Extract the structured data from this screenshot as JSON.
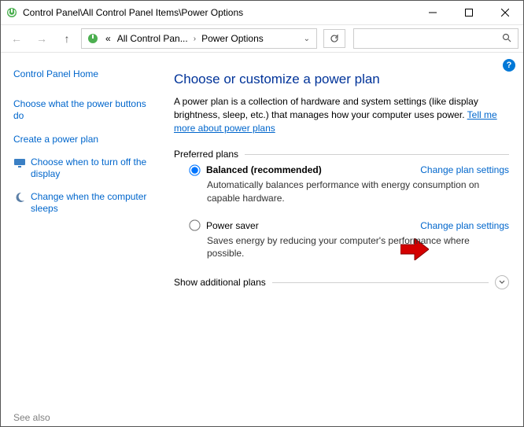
{
  "titlebar": {
    "title": "Control Panel\\All Control Panel Items\\Power Options"
  },
  "navbar": {
    "breadcrumb_prefix": "«",
    "breadcrumb_parent": "All Control Pan...",
    "breadcrumb_current": "Power Options",
    "search_placeholder": ""
  },
  "sidebar": {
    "home": "Control Panel Home",
    "links": [
      "Choose what the power buttons do",
      "Create a power plan"
    ],
    "tasks": [
      "Choose when to turn off the display",
      "Change when the computer sleeps"
    ]
  },
  "main": {
    "heading": "Choose or customize a power plan",
    "description": "A power plan is a collection of hardware and system settings (like display brightness, sleep, etc.) that manages how your computer uses power. ",
    "tell_me_more": "Tell me more about power plans",
    "preferred_label": "Preferred plans",
    "plans": [
      {
        "name": "Balanced (recommended)",
        "desc": "Automatically balances performance with energy consumption on capable hardware.",
        "change": "Change plan settings",
        "selected": true
      },
      {
        "name": "Power saver",
        "desc": "Saves energy by reducing your computer's performance where possible.",
        "change": "Change plan settings",
        "selected": false
      }
    ],
    "show_additional": "Show additional plans"
  },
  "footer": {
    "see_also": "See also"
  }
}
